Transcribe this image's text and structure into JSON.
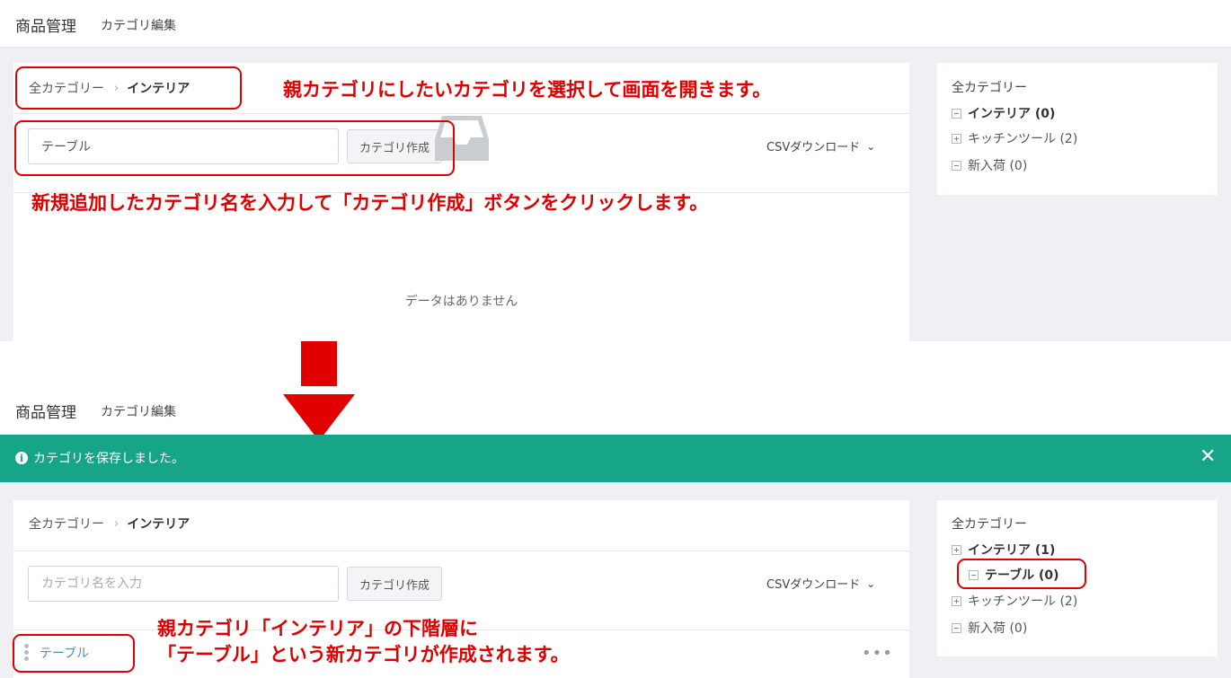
{
  "header": {
    "title": "商品管理",
    "subtitle": "カテゴリ編集"
  },
  "breadcrumb": {
    "root": "全カテゴリー",
    "separator": "›",
    "current": "インテリア"
  },
  "before": {
    "input_value": "テーブル",
    "create_button": "カテゴリ作成",
    "csv_label": "CSVダウンロード",
    "empty_text": "データはありません"
  },
  "after": {
    "input_placeholder": "カテゴリ名を入力",
    "create_button": "カテゴリ作成",
    "csv_label": "CSVダウンロード",
    "row_label": "テーブル",
    "row_menu": "•••"
  },
  "banner": {
    "icon": "info-icon",
    "message": "カテゴリを保存しました。",
    "close": "✕"
  },
  "tree_before": {
    "root": "全カテゴリー",
    "items": [
      {
        "label": "インテリア (0)",
        "toggle": "minus"
      },
      {
        "label": "キッチンツール (2)",
        "toggle": "plus"
      },
      {
        "label": "新入荷 (0)",
        "toggle": "minus"
      }
    ]
  },
  "tree_after": {
    "root": "全カテゴリー",
    "items": [
      {
        "label": "インテリア (1)",
        "toggle": "plus"
      },
      {
        "label": "テーブル (0)",
        "toggle": "minus"
      },
      {
        "label": "キッチンツール (2)",
        "toggle": "plus"
      },
      {
        "label": "新入荷 (0)",
        "toggle": "minus"
      }
    ]
  },
  "annotations": {
    "a1": "親カテゴリにしたいカテゴリを選択して画面を開きます。",
    "a2": "新規追加したカテゴリ名を入力して「カテゴリ作成」ボタンをクリックします。",
    "a3_line1": "親カテゴリ「インテリア」の下階層に",
    "a3_line2": "「テーブル」という新カテゴリが作成されます。"
  },
  "colors": {
    "annotation": "#e00000",
    "banner": "#17a589",
    "link": "#4a8bc9"
  }
}
